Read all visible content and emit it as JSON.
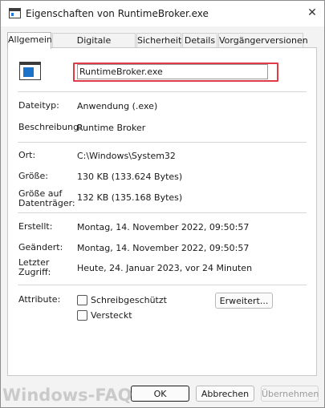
{
  "window": {
    "title": "Eigenschaften von RuntimeBroker.exe",
    "close_glyph": "✕"
  },
  "tabs": [
    {
      "label": "Allgemein",
      "active": true
    },
    {
      "label": "Digitale Signaturen"
    },
    {
      "label": "Sicherheit"
    },
    {
      "label": "Details"
    },
    {
      "label": "Vorgängerversionen"
    }
  ],
  "general": {
    "file_name": "RuntimeBroker.exe",
    "file_type_label": "Dateityp:",
    "file_type_value": "Anwendung (.exe)",
    "description_label": "Beschreibung:",
    "description_value": "Runtime Broker",
    "location_label": "Ort:",
    "location_value": "C:\\Windows\\System32",
    "size_label": "Größe:",
    "size_value": "130 KB (133.624 Bytes)",
    "size_on_disk_label_1": "Größe auf",
    "size_on_disk_label_2": "Datenträger:",
    "size_on_disk_value": "132 KB (135.168 Bytes)",
    "created_label": "Erstellt:",
    "created_value": "Montag, 14. November 2022, 09:50:57",
    "modified_label": "Geändert:",
    "modified_value": "Montag, 14. November 2022, 09:50:57",
    "accessed_label_1": "Letzter",
    "accessed_label_2": "Zugriff:",
    "accessed_value": "Heute, 24. Januar 2023, vor 24 Minuten",
    "attributes_label": "Attribute:",
    "readonly_label": "Schreibgeschützt",
    "hidden_label": "Versteckt",
    "advanced_button": "Erweitert..."
  },
  "footer": {
    "ok": "OK",
    "cancel": "Abbrechen",
    "apply": "Übernehmen"
  },
  "watermark": "Windows-FAQ",
  "colors": {
    "highlight": "#e03b48",
    "icon_blue": "#1a73c8"
  }
}
